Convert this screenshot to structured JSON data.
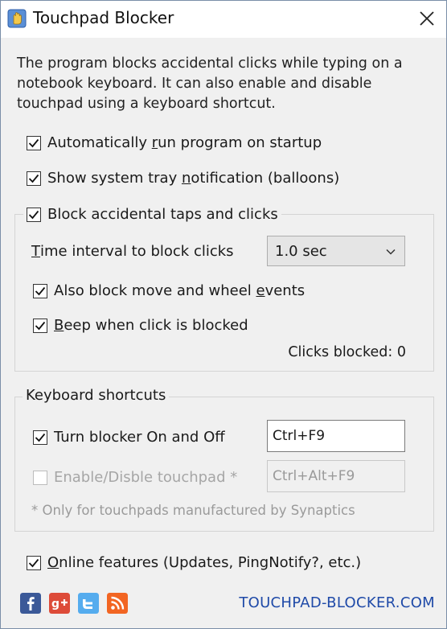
{
  "window": {
    "title": "Touchpad Blocker",
    "close_glyph": "✕"
  },
  "description": "The program blocks accidental clicks while typing on a notebook keyboard. It can also enable and disable touchpad using a keyboard shortcut.",
  "options": {
    "autorun": {
      "pre": "Automatically ",
      "u": "r",
      "post": "un program on startup",
      "checked": true
    },
    "tray": {
      "pre": "Show system tray ",
      "u": "n",
      "post": "otification (balloons)",
      "checked": true
    }
  },
  "block_group": {
    "checkbox_label": "Block accidental taps and clicks",
    "checked": true,
    "interval_label_u": "T",
    "interval_label_rest": "ime interval to block clicks",
    "interval_value": "1.0 sec",
    "move_wheel": {
      "pre": "Also block move and wheel ",
      "u": "e",
      "post": "vents",
      "checked": true
    },
    "beep": {
      "u": "B",
      "post": "eep when click is blocked",
      "checked": true
    },
    "clicks_blocked": "Clicks blocked: 0"
  },
  "shortcuts_group": {
    "legend": "Keyboard shortcuts",
    "toggle": {
      "label": "Turn blocker On and Off",
      "checked": true,
      "value": "Ctrl+F9"
    },
    "touchpad": {
      "label": "Enable/Disble touchpad *",
      "checked": false,
      "value": "Ctrl+Alt+F9"
    },
    "note": "* Only for touchpads manufactured by Synaptics"
  },
  "online": {
    "u": "O",
    "post": "nline features (Updates, PingNotify?, etc.)",
    "checked": true
  },
  "footer": {
    "site": "TOUCHPAD-BLOCKER.COM",
    "social_icons": [
      "facebook-icon",
      "google-plus-icon",
      "twitter-icon",
      "rss-icon"
    ],
    "social_colors": [
      "#3b5998",
      "#dd4b39",
      "#55acee",
      "#f26522"
    ]
  }
}
